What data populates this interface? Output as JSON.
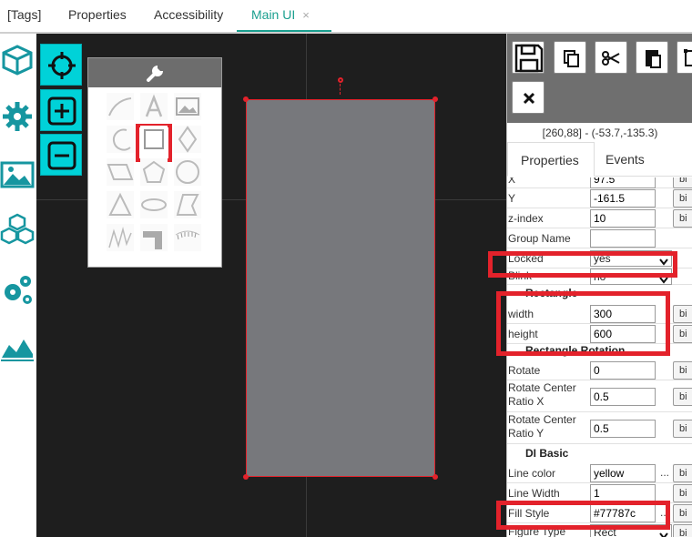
{
  "tabs": [
    {
      "label": "[Tags]"
    },
    {
      "label": "Properties"
    },
    {
      "label": "Accessibility"
    },
    {
      "label": "Main UI",
      "close": "×"
    }
  ],
  "rail": {
    "icons": [
      "cube-icon",
      "gear-icon",
      "image-icon",
      "blocks-icon",
      "gears-icon",
      "area-chart-icon"
    ]
  },
  "toolbar": {
    "buttons": [
      "crosshair-icon",
      "zoom-in-icon",
      "zoom-out-icon"
    ]
  },
  "palette": {
    "header_icon": "wrench-icon",
    "shapes": [
      [
        "curve-icon",
        "text-icon",
        "image-icon"
      ],
      [
        "arc-icon",
        "rectangle-icon",
        "diamond-icon"
      ],
      [
        "parallelogram-icon",
        "pentagon-icon",
        "circle-icon"
      ],
      [
        "triangle-icon",
        "ellipse-icon",
        "polygon-icon"
      ],
      [
        "polyline-icon",
        "pipe-icon",
        "gauge-icon"
      ]
    ],
    "selected": "rectangle-icon"
  },
  "panel": {
    "toolbar": [
      "save-icon",
      "copy-icon",
      "cut-icon",
      "paste-icon",
      "transform-icon",
      "delete-icon"
    ],
    "coords": "[260,88] - (-53.7,-135.3)",
    "tabs": {
      "properties": "Properties",
      "events": "Events"
    },
    "bind_label": "bi",
    "rows": {
      "x": {
        "label": "X",
        "value": "97.5"
      },
      "y": {
        "label": "Y",
        "value": "-161.5"
      },
      "zindex": {
        "label": "z-index",
        "value": "10"
      },
      "group": {
        "label": "Group Name",
        "value": ""
      },
      "locked": {
        "label": "Locked",
        "value": "yes"
      },
      "blink": {
        "label": "Blink",
        "value": "no"
      }
    },
    "sections": {
      "rectangle": "Rectangle",
      "rotation": "Rectangle Rotation",
      "basic": "DI Basic"
    },
    "rect": {
      "width": {
        "label": "width",
        "value": "300"
      },
      "height": {
        "label": "height",
        "value": "600"
      }
    },
    "rotation": {
      "rotate": {
        "label": "Rotate",
        "value": "0"
      },
      "cx": {
        "label": "Rotate Center Ratio X",
        "value": "0.5"
      },
      "cy": {
        "label": "Rotate Center Ratio Y",
        "value": "0.5"
      }
    },
    "basic": {
      "line_color": {
        "label": "Line color",
        "value": "yellow"
      },
      "line_width": {
        "label": "Line Width",
        "value": "1"
      },
      "fill_style": {
        "label": "Fill Style",
        "value": "#77787c"
      },
      "figure_type": {
        "label": "Figure Type",
        "value": "Rect"
      }
    },
    "dots": "..."
  },
  "colors": {
    "accent": "#1a9f8f",
    "tool_cyan": "#00d2d8",
    "highlight": "#e3222b",
    "shape_fill": "#77787c",
    "canvas_bg": "#1e1e1e"
  }
}
